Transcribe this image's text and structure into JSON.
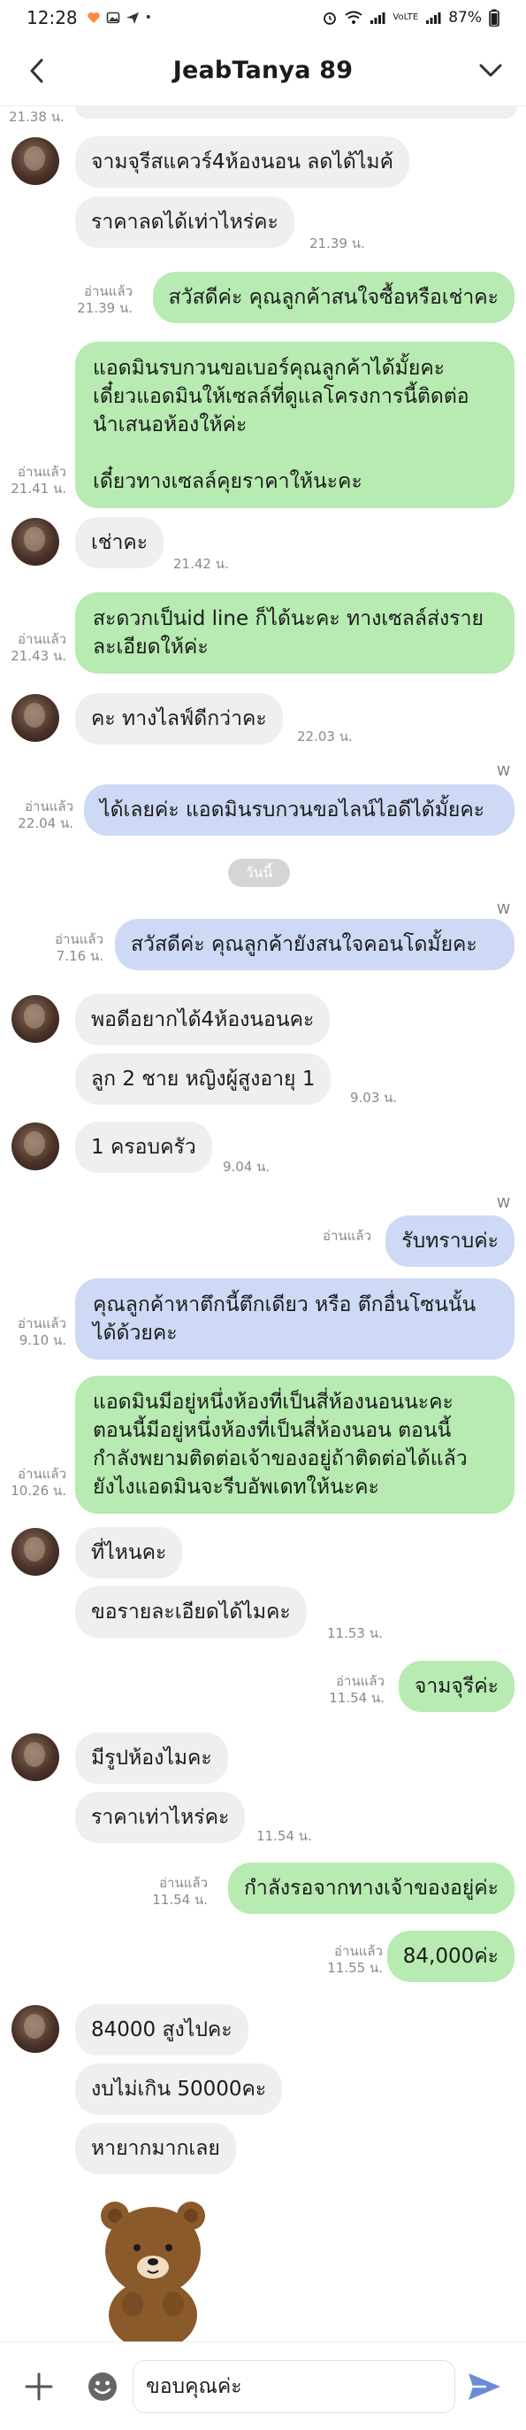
{
  "status": {
    "time": "12:28",
    "battery": "87%",
    "network": "VoLTE"
  },
  "header": {
    "title": "JeabTanya 89"
  },
  "read_label": "อ่านแล้ว",
  "top_time": "21.38 น.",
  "messages": [
    {
      "id": "m1",
      "side": "in",
      "text": "จามจุรีสแควร์4ห้องนอน ลดได้ไมค้",
      "time": ""
    },
    {
      "id": "m2",
      "side": "in",
      "text": "ราคาลดได้เท่าไหร่คะ",
      "time": "21.39 น."
    },
    {
      "id": "m3",
      "side": "out",
      "text": "สวัสดีค่ะ คุณลูกค้าสนใจซื้อหรือเช่าคะ",
      "time": "21.39 น."
    },
    {
      "id": "m4",
      "side": "out",
      "text": "แอดมินรบกวนขอเบอร์คุณลูกค้าได้มั้ยคะ\nเดี๋ยวแอดมินให้เซลล์ที่ดูแลโครงการนี้ติดต่อ\nนำเสนอห้องให้ค่ะ\n\nเดี๋ยวทางเซลล์คุยราคาให้นะคะ",
      "time": "21.41 น."
    },
    {
      "id": "m5",
      "side": "in",
      "text": "เช่าคะ",
      "time": "21.42 น."
    },
    {
      "id": "m6",
      "side": "out",
      "text": "สะดวกเป็นid line ก็ได้นะคะ ทางเซลล์ส่งราย\nละเอียดให้ค่ะ",
      "time": "21.43 น."
    },
    {
      "id": "m7",
      "side": "in",
      "text": "คะ ทางไลฟ์ดีกว่าคะ",
      "time": "22.03 น."
    },
    {
      "id": "m8",
      "side": "out",
      "text": "ได้เลยค่ะ แอดมินรบกวนขอไลน์ไอดีได้มั้ยคะ",
      "time": "22.04 น.",
      "tag": "W"
    },
    {
      "id": "m9",
      "side": "out",
      "text": "สวัสดีค่ะ คุณลูกค้ายังสนใจคอนโดมั้ยคะ",
      "time": "7.16 น.",
      "tag": "W"
    },
    {
      "id": "m10",
      "side": "in",
      "text": "พอดีอยากได้4ห้องนอนคะ",
      "time": ""
    },
    {
      "id": "m11",
      "side": "in",
      "text": "ลูก 2 ชาย หญิงผู้สูงอายุ 1",
      "time": "9.03 น."
    },
    {
      "id": "m12",
      "side": "in",
      "text": "1 ครอบครัว",
      "time": "9.04 น."
    },
    {
      "id": "m13",
      "side": "out",
      "text": "รับทราบค่ะ",
      "time": "",
      "tag": "W"
    },
    {
      "id": "m14",
      "side": "out",
      "text": "คุณลูกค้าหาตึกนี้ตึกเดียว หรือ ตึกอื่นโซนนั้น\nได้ด้วยคะ",
      "time": "9.10 น."
    },
    {
      "id": "m15",
      "side": "out",
      "text": "แอดมินมีอยู่หนึ่งห้องที่เป็นสี่ห้องนอนนะคะ\nตอนนี้มีอยู่หนึ่งห้องที่เป็นสี่ห้องนอน ตอนนี้\nกำลังพยามติดต่อเจ้าของอยู่ถ้าติดต่อได้แล้ว\nยังไงแอดมินจะรีบอัพเดทให้นะคะ",
      "time": "10.26 น."
    },
    {
      "id": "m16",
      "side": "in",
      "text": "ที่ไหนคะ",
      "time": ""
    },
    {
      "id": "m17",
      "side": "in",
      "text": "ขอรายละเอียดได้ไมคะ",
      "time": "11.53 น."
    },
    {
      "id": "m18",
      "side": "out",
      "text": "จามจุรีค่ะ",
      "time": "11.54 น."
    },
    {
      "id": "m19",
      "side": "in",
      "text": "มีรูปห้องไมคะ",
      "time": ""
    },
    {
      "id": "m20",
      "side": "in",
      "text": "ราคาเท่าไหร่คะ",
      "time": "11.54 น."
    },
    {
      "id": "m21",
      "side": "out",
      "text": "กำลังรอจากทางเจ้าของอยู่ค่ะ",
      "time": "11.54 น."
    },
    {
      "id": "m22",
      "side": "out",
      "text": "84,000ค่ะ",
      "time": "11.55 น."
    },
    {
      "id": "m23",
      "side": "in",
      "text": "84000 สูงไปคะ",
      "time": ""
    },
    {
      "id": "m24",
      "side": "in",
      "text": "งบไม่เกิน 50000คะ",
      "time": ""
    },
    {
      "id": "m25",
      "side": "in",
      "text": "หายากมากเลย",
      "time": ""
    }
  ],
  "date_divider": "วันนี้",
  "input": {
    "value": "ขอบคุณค่ะ"
  },
  "colors": {
    "out_green": "#b7ebb1",
    "out_blue": "#cdd9f5",
    "in_gray": "#efefef",
    "send": "#6b8bd6"
  }
}
